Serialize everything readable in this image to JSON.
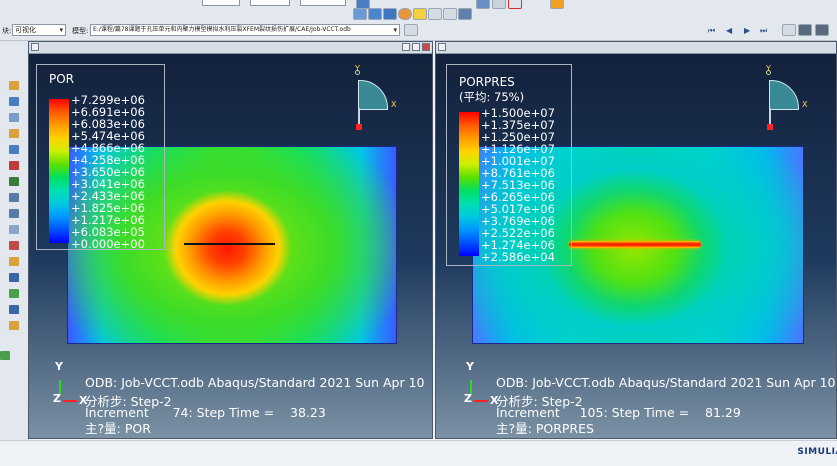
{
  "toolbar": {
    "module_label": "块:",
    "module_value": "可视化",
    "model_label": "模型:",
    "model_path": "E:/课程/篇78课题于孔压单元和内聚力模型模拟水利压裂XFEM裂纹损伤扩展/CAE/Job-VCCT.odb"
  },
  "viewports": [
    {
      "variable": "POR",
      "subtitle": "",
      "ticks": [
        "+7.299e+06",
        "+6.691e+06",
        "+6.083e+06",
        "+5.474e+06",
        "+4.866e+06",
        "+4.258e+06",
        "+3.650e+06",
        "+3.041e+06",
        "+2.433e+06",
        "+1.825e+06",
        "+1.217e+06",
        "+6.083e+05",
        "+0.000e+00"
      ],
      "odb_line": "ODB: Job-VCCT.odb    Abaqus/Standard 2021    Sun Apr 10",
      "step_line": "分析步: Step-2",
      "increment_line": "Increment      74: Step Time =    38.23",
      "primary_var_line": "主?量: POR"
    },
    {
      "variable": "PORPRES",
      "subtitle": "(平均: 75%)",
      "ticks": [
        "+1.500e+07",
        "+1.375e+07",
        "+1.250e+07",
        "+1.126e+07",
        "+1.001e+07",
        "+8.761e+06",
        "+7.513e+06",
        "+6.265e+06",
        "+5.017e+06",
        "+3.769e+06",
        "+2.522e+06",
        "+1.274e+06",
        "+2.586e+04"
      ],
      "odb_line": "ODB: Job-VCCT.odb    Abaqus/Standard 2021    Sun Apr 10",
      "step_line": "分析步: Step-2",
      "increment_line": "Increment     105: Step Time =    81.29",
      "primary_var_line": "主?量: PORPRES"
    }
  ],
  "axes": {
    "x": "X",
    "y": "Y",
    "z": "Z"
  },
  "status": {
    "brand": "SIMULIA"
  },
  "colors": {
    "accent_red": "#ff2222",
    "triad_fill": "#3a8a96"
  }
}
